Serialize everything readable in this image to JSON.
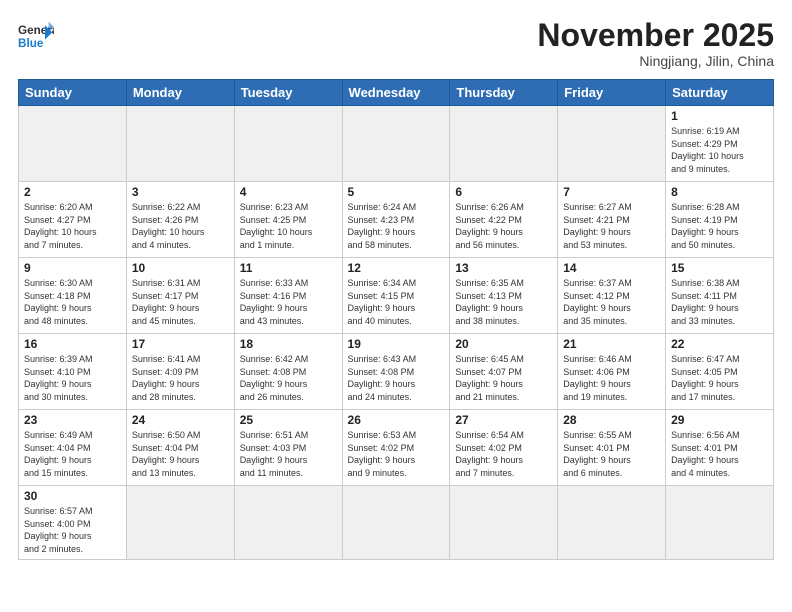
{
  "header": {
    "logo_general": "General",
    "logo_blue": "Blue",
    "month_title": "November 2025",
    "location": "Ningjiang, Jilin, China"
  },
  "weekdays": [
    "Sunday",
    "Monday",
    "Tuesday",
    "Wednesday",
    "Thursday",
    "Friday",
    "Saturday"
  ],
  "weeks": [
    [
      {
        "day": "",
        "info": ""
      },
      {
        "day": "",
        "info": ""
      },
      {
        "day": "",
        "info": ""
      },
      {
        "day": "",
        "info": ""
      },
      {
        "day": "",
        "info": ""
      },
      {
        "day": "",
        "info": ""
      },
      {
        "day": "1",
        "info": "Sunrise: 6:19 AM\nSunset: 4:29 PM\nDaylight: 10 hours\nand 9 minutes."
      }
    ],
    [
      {
        "day": "2",
        "info": "Sunrise: 6:20 AM\nSunset: 4:27 PM\nDaylight: 10 hours\nand 7 minutes."
      },
      {
        "day": "3",
        "info": "Sunrise: 6:22 AM\nSunset: 4:26 PM\nDaylight: 10 hours\nand 4 minutes."
      },
      {
        "day": "4",
        "info": "Sunrise: 6:23 AM\nSunset: 4:25 PM\nDaylight: 10 hours\nand 1 minute."
      },
      {
        "day": "5",
        "info": "Sunrise: 6:24 AM\nSunset: 4:23 PM\nDaylight: 9 hours\nand 58 minutes."
      },
      {
        "day": "6",
        "info": "Sunrise: 6:26 AM\nSunset: 4:22 PM\nDaylight: 9 hours\nand 56 minutes."
      },
      {
        "day": "7",
        "info": "Sunrise: 6:27 AM\nSunset: 4:21 PM\nDaylight: 9 hours\nand 53 minutes."
      },
      {
        "day": "8",
        "info": "Sunrise: 6:28 AM\nSunset: 4:19 PM\nDaylight: 9 hours\nand 50 minutes."
      }
    ],
    [
      {
        "day": "9",
        "info": "Sunrise: 6:30 AM\nSunset: 4:18 PM\nDaylight: 9 hours\nand 48 minutes."
      },
      {
        "day": "10",
        "info": "Sunrise: 6:31 AM\nSunset: 4:17 PM\nDaylight: 9 hours\nand 45 minutes."
      },
      {
        "day": "11",
        "info": "Sunrise: 6:33 AM\nSunset: 4:16 PM\nDaylight: 9 hours\nand 43 minutes."
      },
      {
        "day": "12",
        "info": "Sunrise: 6:34 AM\nSunset: 4:15 PM\nDaylight: 9 hours\nand 40 minutes."
      },
      {
        "day": "13",
        "info": "Sunrise: 6:35 AM\nSunset: 4:13 PM\nDaylight: 9 hours\nand 38 minutes."
      },
      {
        "day": "14",
        "info": "Sunrise: 6:37 AM\nSunset: 4:12 PM\nDaylight: 9 hours\nand 35 minutes."
      },
      {
        "day": "15",
        "info": "Sunrise: 6:38 AM\nSunset: 4:11 PM\nDaylight: 9 hours\nand 33 minutes."
      }
    ],
    [
      {
        "day": "16",
        "info": "Sunrise: 6:39 AM\nSunset: 4:10 PM\nDaylight: 9 hours\nand 30 minutes."
      },
      {
        "day": "17",
        "info": "Sunrise: 6:41 AM\nSunset: 4:09 PM\nDaylight: 9 hours\nand 28 minutes."
      },
      {
        "day": "18",
        "info": "Sunrise: 6:42 AM\nSunset: 4:08 PM\nDaylight: 9 hours\nand 26 minutes."
      },
      {
        "day": "19",
        "info": "Sunrise: 6:43 AM\nSunset: 4:08 PM\nDaylight: 9 hours\nand 24 minutes."
      },
      {
        "day": "20",
        "info": "Sunrise: 6:45 AM\nSunset: 4:07 PM\nDaylight: 9 hours\nand 21 minutes."
      },
      {
        "day": "21",
        "info": "Sunrise: 6:46 AM\nSunset: 4:06 PM\nDaylight: 9 hours\nand 19 minutes."
      },
      {
        "day": "22",
        "info": "Sunrise: 6:47 AM\nSunset: 4:05 PM\nDaylight: 9 hours\nand 17 minutes."
      }
    ],
    [
      {
        "day": "23",
        "info": "Sunrise: 6:49 AM\nSunset: 4:04 PM\nDaylight: 9 hours\nand 15 minutes."
      },
      {
        "day": "24",
        "info": "Sunrise: 6:50 AM\nSunset: 4:04 PM\nDaylight: 9 hours\nand 13 minutes."
      },
      {
        "day": "25",
        "info": "Sunrise: 6:51 AM\nSunset: 4:03 PM\nDaylight: 9 hours\nand 11 minutes."
      },
      {
        "day": "26",
        "info": "Sunrise: 6:53 AM\nSunset: 4:02 PM\nDaylight: 9 hours\nand 9 minutes."
      },
      {
        "day": "27",
        "info": "Sunrise: 6:54 AM\nSunset: 4:02 PM\nDaylight: 9 hours\nand 7 minutes."
      },
      {
        "day": "28",
        "info": "Sunrise: 6:55 AM\nSunset: 4:01 PM\nDaylight: 9 hours\nand 6 minutes."
      },
      {
        "day": "29",
        "info": "Sunrise: 6:56 AM\nSunset: 4:01 PM\nDaylight: 9 hours\nand 4 minutes."
      }
    ],
    [
      {
        "day": "30",
        "info": "Sunrise: 6:57 AM\nSunset: 4:00 PM\nDaylight: 9 hours\nand 2 minutes."
      },
      {
        "day": "",
        "info": ""
      },
      {
        "day": "",
        "info": ""
      },
      {
        "day": "",
        "info": ""
      },
      {
        "day": "",
        "info": ""
      },
      {
        "day": "",
        "info": ""
      },
      {
        "day": "",
        "info": ""
      }
    ]
  ]
}
